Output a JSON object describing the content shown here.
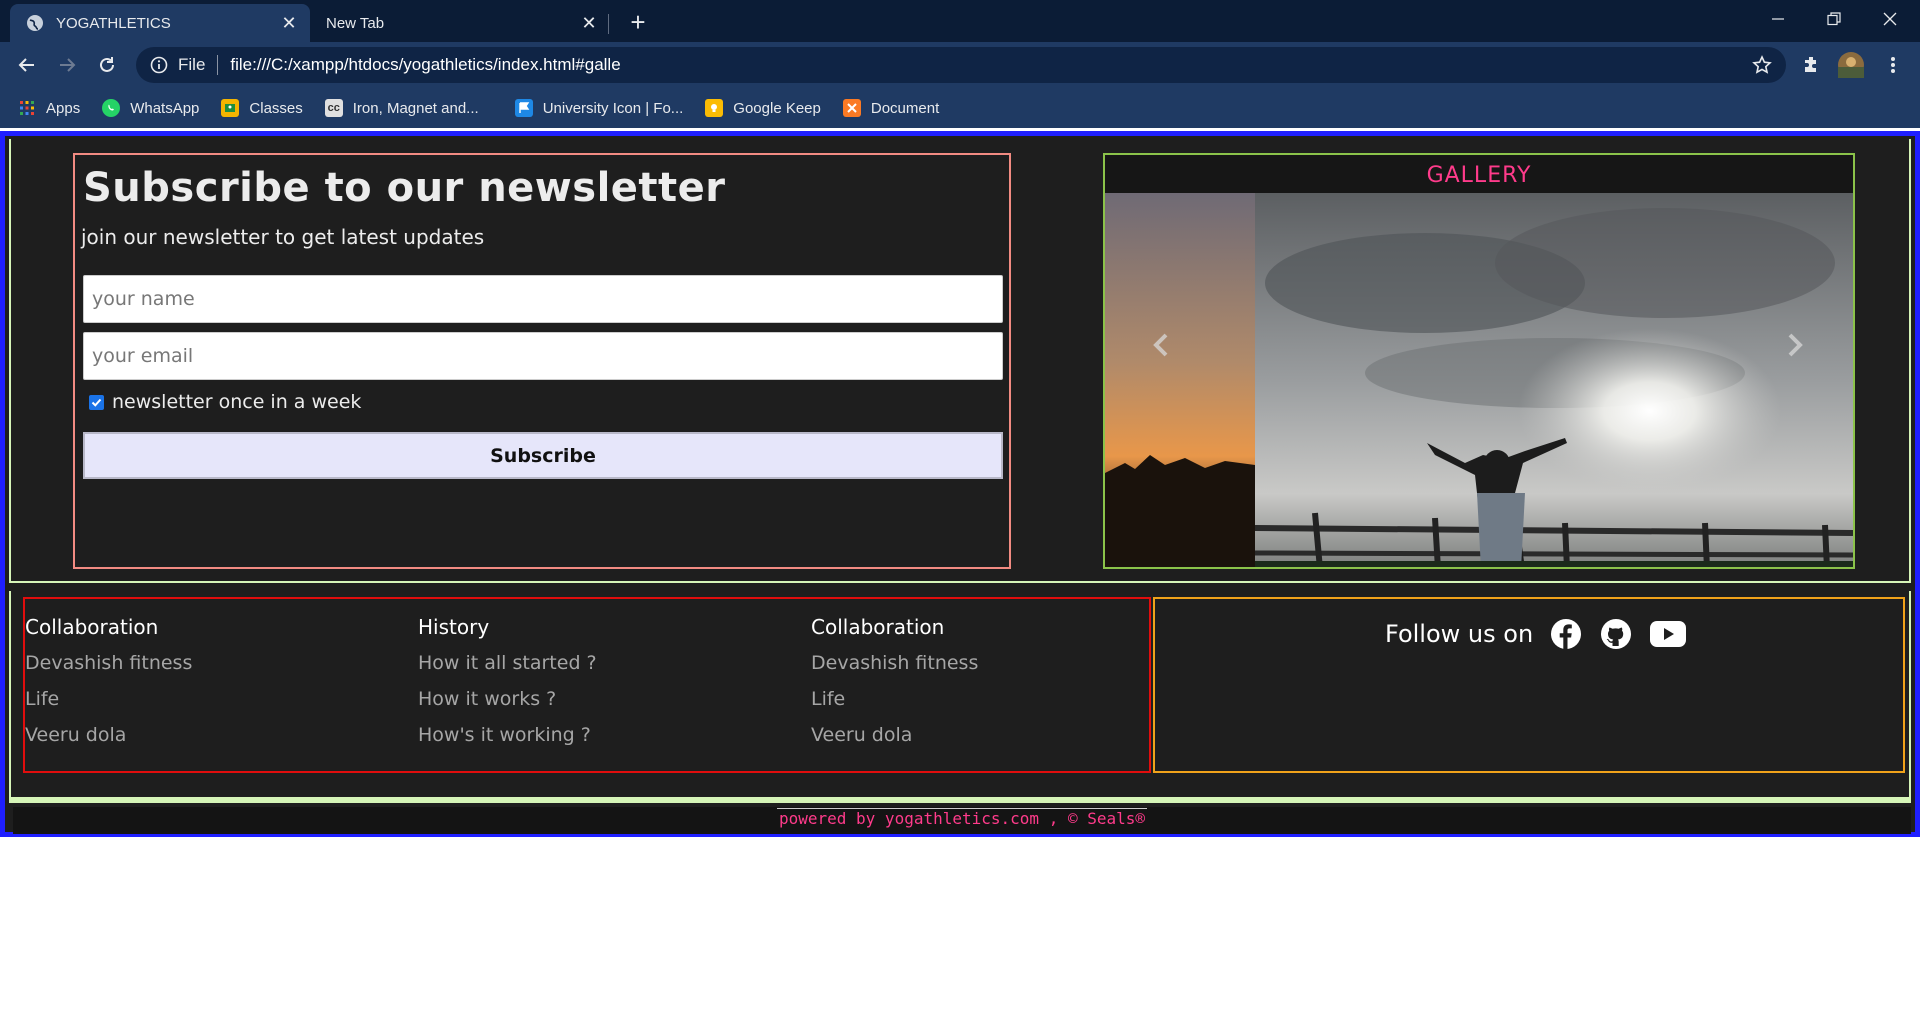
{
  "browser": {
    "tabs": [
      {
        "title": "YOGATHLETICS",
        "active": true
      },
      {
        "title": "New Tab",
        "active": false
      }
    ],
    "address": {
      "scheme": "File",
      "url": "file:///C:/xampp/htdocs/yogathletics/index.html#galle"
    },
    "bookmarks": [
      {
        "label": "Apps",
        "icon": "apps-grid-icon"
      },
      {
        "label": "WhatsApp",
        "icon": "whatsapp-icon",
        "color": "#25d366"
      },
      {
        "label": "Classes",
        "icon": "classroom-icon",
        "color": "#f4b400"
      },
      {
        "label": "Iron, Magnet and...",
        "icon": "cc-icon",
        "color": "#cccccc"
      },
      {
        "label": "University Icon | Fo...",
        "icon": "flag-icon",
        "color": "#1e88e5"
      },
      {
        "label": "Google Keep",
        "icon": "keep-icon",
        "color": "#fbbc04"
      },
      {
        "label": "Document",
        "icon": "xampp-icon",
        "color": "#fb7a24"
      }
    ]
  },
  "newsletter": {
    "title": "Subscribe to our newsletter",
    "subtitle": "join our newsletter to get latest updates",
    "name_placeholder": "your name",
    "email_placeholder": "your email",
    "checkbox_label": "newsletter once in a week",
    "checkbox_checked": true,
    "button_label": "Subscribe"
  },
  "gallery": {
    "title": "GALLERY"
  },
  "footer": {
    "columns": [
      {
        "heading": "Collaboration",
        "links": [
          "Devashish fitness",
          "Life",
          "Veeru dola"
        ]
      },
      {
        "heading": "History",
        "links": [
          "How it all started ?",
          "How it works ?",
          "How's it working ?"
        ]
      },
      {
        "heading": "Collaboration",
        "links": [
          "Devashish fitness",
          "Life",
          "Veeru dola"
        ]
      }
    ],
    "follow_label": "Follow us on",
    "social": [
      "facebook-icon",
      "github-icon",
      "youtube-icon"
    ],
    "powered_by": "powered by yogathletics.com , © Seals®"
  },
  "colors": {
    "page_border": "#1f1fff",
    "accent_pink": "#ff3b8b",
    "newsletter_border": "#f28b82",
    "gallery_border": "#8bc34a",
    "links_border": "#e10d0d",
    "follow_border": "#f0a21a"
  }
}
